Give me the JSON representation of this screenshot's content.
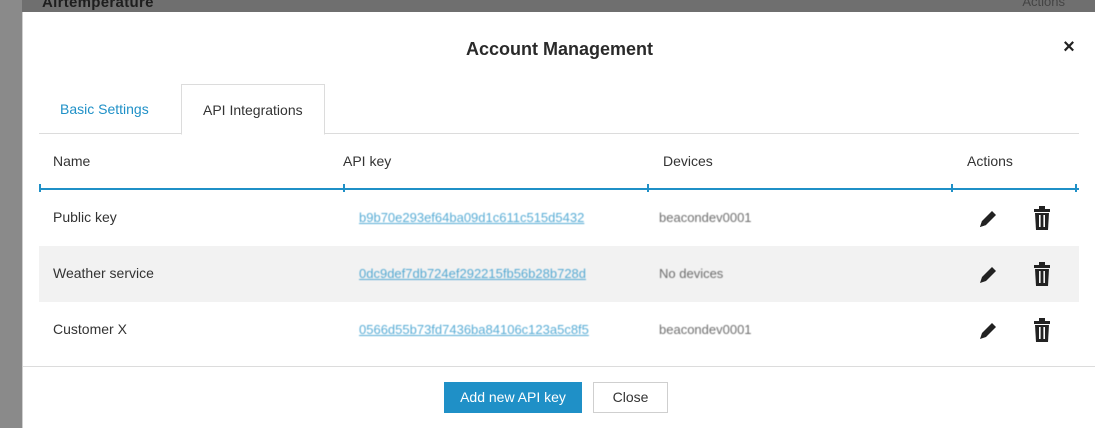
{
  "backdrop": {
    "left_text": "Airtemperature",
    "right_text": "Actions"
  },
  "modal": {
    "title": "Account Management",
    "close_glyph": "×"
  },
  "tabs": [
    {
      "label": "Basic Settings",
      "active": false
    },
    {
      "label": "API Integrations",
      "active": true
    }
  ],
  "table": {
    "columns": [
      "Name",
      "API key",
      "Devices",
      "Actions"
    ],
    "rows": [
      {
        "name": "Public key",
        "api_key": "b9b70e293ef64ba09d1c611c515d5432",
        "devices": "beacondev0001"
      },
      {
        "name": "Weather service",
        "api_key": "0dc9def7db724ef292215fb56b28b728d",
        "devices": "No devices"
      },
      {
        "name": "Customer X",
        "api_key": "0566d55b73fd7436ba84106c123a5c8f5",
        "devices": "beacondev0001"
      }
    ]
  },
  "actions": {
    "edit_icon": "pencil-icon",
    "delete_icon": "trash-icon"
  },
  "footer": {
    "add_label": "Add new API key",
    "close_label": "Close"
  },
  "colors": {
    "accent": "#1f90c7",
    "stripe": "#f2f2f2"
  }
}
